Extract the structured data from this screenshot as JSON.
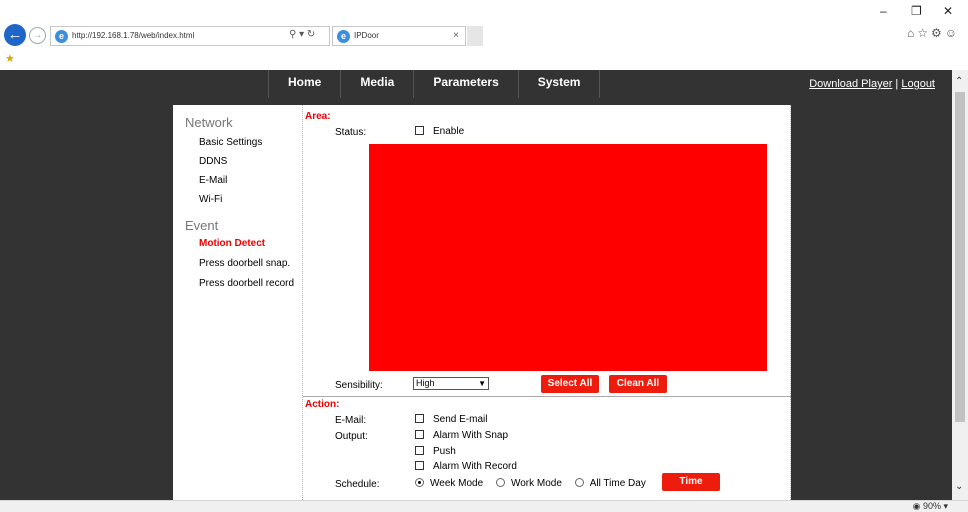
{
  "browser": {
    "url": "http://192.168.1.78/web/index.html",
    "search_icon": "search-icon",
    "tab_title": "IPDoor",
    "tab_close": "×",
    "win_minimize": "–",
    "win_restore": "❐",
    "win_close": "✕",
    "tool_icons": "⌂☆⚙☺",
    "zoom": "90%"
  },
  "topnav": {
    "items": [
      "Home",
      "Media",
      "Parameters",
      "System"
    ],
    "download_player": "Download Player",
    "separator": " | ",
    "logout": "Logout"
  },
  "sidebar": {
    "network_heading": "Network",
    "network_items": [
      "Basic Settings",
      "DDNS",
      "E-Mail",
      "Wi-Fi"
    ],
    "event_heading": "Event",
    "event_items": [
      "Motion Detect",
      "Press doorbell snap.",
      "Press doorbell record"
    ],
    "active_item": "Motion Detect"
  },
  "main": {
    "area_heading": "Area:",
    "status_label": "Status:",
    "enable_label": "Enable",
    "area_color": "#ff0000",
    "sensibility_label": "Sensibility:",
    "sensibility_value": "High",
    "select_all": "Select All",
    "clean_all": "Clean All",
    "action_heading": "Action:",
    "email_label": "E-Mail:",
    "send_email": "Send E-mail",
    "output_label": "Output:",
    "alarm_with_snap": "Alarm With Snap",
    "push": "Push",
    "alarm_with_record": "Alarm With Record",
    "schedule_label": "Schedule:",
    "week_mode": "Week Mode",
    "work_mode": "Work Mode",
    "all_time_day": "All Time Day",
    "time_button": "Time"
  },
  "colors": {
    "accent_red": "#ee1c0c",
    "nav_bg": "#333333",
    "active_text": "#ee0000"
  }
}
